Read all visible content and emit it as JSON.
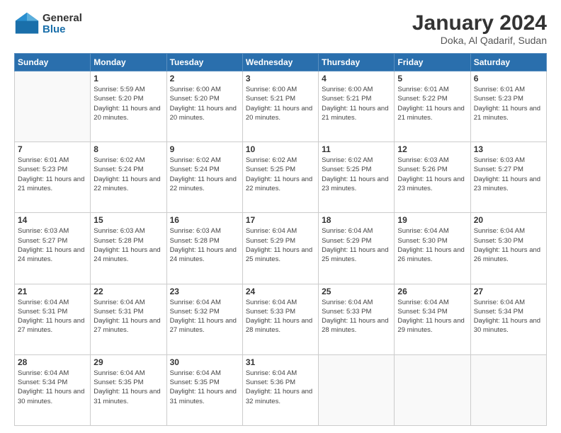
{
  "header": {
    "logo_general": "General",
    "logo_blue": "Blue",
    "main_title": "January 2024",
    "sub_title": "Doka, Al Qadarif, Sudan"
  },
  "calendar": {
    "days_of_week": [
      "Sunday",
      "Monday",
      "Tuesday",
      "Wednesday",
      "Thursday",
      "Friday",
      "Saturday"
    ],
    "weeks": [
      [
        {
          "day": "",
          "info": ""
        },
        {
          "day": "1",
          "info": "Sunrise: 5:59 AM\nSunset: 5:20 PM\nDaylight: 11 hours\nand 20 minutes."
        },
        {
          "day": "2",
          "info": "Sunrise: 6:00 AM\nSunset: 5:20 PM\nDaylight: 11 hours\nand 20 minutes."
        },
        {
          "day": "3",
          "info": "Sunrise: 6:00 AM\nSunset: 5:21 PM\nDaylight: 11 hours\nand 20 minutes."
        },
        {
          "day": "4",
          "info": "Sunrise: 6:00 AM\nSunset: 5:21 PM\nDaylight: 11 hours\nand 21 minutes."
        },
        {
          "day": "5",
          "info": "Sunrise: 6:01 AM\nSunset: 5:22 PM\nDaylight: 11 hours\nand 21 minutes."
        },
        {
          "day": "6",
          "info": "Sunrise: 6:01 AM\nSunset: 5:23 PM\nDaylight: 11 hours\nand 21 minutes."
        }
      ],
      [
        {
          "day": "7",
          "info": "Sunrise: 6:01 AM\nSunset: 5:23 PM\nDaylight: 11 hours\nand 21 minutes."
        },
        {
          "day": "8",
          "info": "Sunrise: 6:02 AM\nSunset: 5:24 PM\nDaylight: 11 hours\nand 22 minutes."
        },
        {
          "day": "9",
          "info": "Sunrise: 6:02 AM\nSunset: 5:24 PM\nDaylight: 11 hours\nand 22 minutes."
        },
        {
          "day": "10",
          "info": "Sunrise: 6:02 AM\nSunset: 5:25 PM\nDaylight: 11 hours\nand 22 minutes."
        },
        {
          "day": "11",
          "info": "Sunrise: 6:02 AM\nSunset: 5:25 PM\nDaylight: 11 hours\nand 23 minutes."
        },
        {
          "day": "12",
          "info": "Sunrise: 6:03 AM\nSunset: 5:26 PM\nDaylight: 11 hours\nand 23 minutes."
        },
        {
          "day": "13",
          "info": "Sunrise: 6:03 AM\nSunset: 5:27 PM\nDaylight: 11 hours\nand 23 minutes."
        }
      ],
      [
        {
          "day": "14",
          "info": "Sunrise: 6:03 AM\nSunset: 5:27 PM\nDaylight: 11 hours\nand 24 minutes."
        },
        {
          "day": "15",
          "info": "Sunrise: 6:03 AM\nSunset: 5:28 PM\nDaylight: 11 hours\nand 24 minutes."
        },
        {
          "day": "16",
          "info": "Sunrise: 6:03 AM\nSunset: 5:28 PM\nDaylight: 11 hours\nand 24 minutes."
        },
        {
          "day": "17",
          "info": "Sunrise: 6:04 AM\nSunset: 5:29 PM\nDaylight: 11 hours\nand 25 minutes."
        },
        {
          "day": "18",
          "info": "Sunrise: 6:04 AM\nSunset: 5:29 PM\nDaylight: 11 hours\nand 25 minutes."
        },
        {
          "day": "19",
          "info": "Sunrise: 6:04 AM\nSunset: 5:30 PM\nDaylight: 11 hours\nand 26 minutes."
        },
        {
          "day": "20",
          "info": "Sunrise: 6:04 AM\nSunset: 5:30 PM\nDaylight: 11 hours\nand 26 minutes."
        }
      ],
      [
        {
          "day": "21",
          "info": "Sunrise: 6:04 AM\nSunset: 5:31 PM\nDaylight: 11 hours\nand 27 minutes."
        },
        {
          "day": "22",
          "info": "Sunrise: 6:04 AM\nSunset: 5:31 PM\nDaylight: 11 hours\nand 27 minutes."
        },
        {
          "day": "23",
          "info": "Sunrise: 6:04 AM\nSunset: 5:32 PM\nDaylight: 11 hours\nand 27 minutes."
        },
        {
          "day": "24",
          "info": "Sunrise: 6:04 AM\nSunset: 5:33 PM\nDaylight: 11 hours\nand 28 minutes."
        },
        {
          "day": "25",
          "info": "Sunrise: 6:04 AM\nSunset: 5:33 PM\nDaylight: 11 hours\nand 28 minutes."
        },
        {
          "day": "26",
          "info": "Sunrise: 6:04 AM\nSunset: 5:34 PM\nDaylight: 11 hours\nand 29 minutes."
        },
        {
          "day": "27",
          "info": "Sunrise: 6:04 AM\nSunset: 5:34 PM\nDaylight: 11 hours\nand 30 minutes."
        }
      ],
      [
        {
          "day": "28",
          "info": "Sunrise: 6:04 AM\nSunset: 5:34 PM\nDaylight: 11 hours\nand 30 minutes."
        },
        {
          "day": "29",
          "info": "Sunrise: 6:04 AM\nSunset: 5:35 PM\nDaylight: 11 hours\nand 31 minutes."
        },
        {
          "day": "30",
          "info": "Sunrise: 6:04 AM\nSunset: 5:35 PM\nDaylight: 11 hours\nand 31 minutes."
        },
        {
          "day": "31",
          "info": "Sunrise: 6:04 AM\nSunset: 5:36 PM\nDaylight: 11 hours\nand 32 minutes."
        },
        {
          "day": "",
          "info": ""
        },
        {
          "day": "",
          "info": ""
        },
        {
          "day": "",
          "info": ""
        }
      ]
    ]
  }
}
